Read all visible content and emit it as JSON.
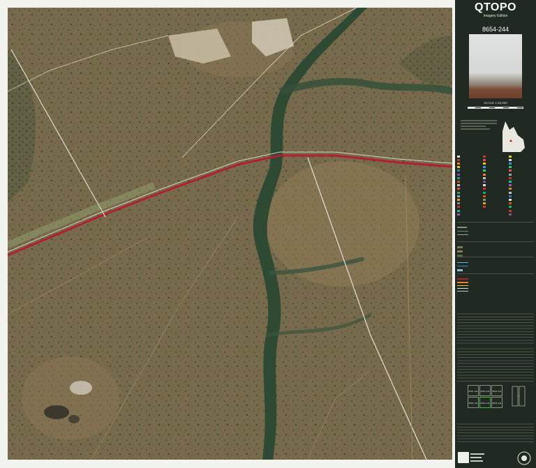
{
  "header": {
    "title": "QTOPO",
    "subtitle": "Imagery Edition",
    "sheet_number": "8654-244",
    "scale": "SCALE 1:10,000"
  },
  "colors": {
    "panel_bg": "#202a22",
    "frame_bg": "#f2f2ee",
    "road_red": "#b02030",
    "vegetation_dark": "#2f4a33",
    "terrain_brown": "#7d6b4d",
    "index_highlight": "#3fbf3f"
  },
  "index_map": {
    "cells": [
      "8654-143",
      "8654-243",
      "8654-343",
      "8654-144",
      "8654-244",
      "8654-344"
    ]
  }
}
